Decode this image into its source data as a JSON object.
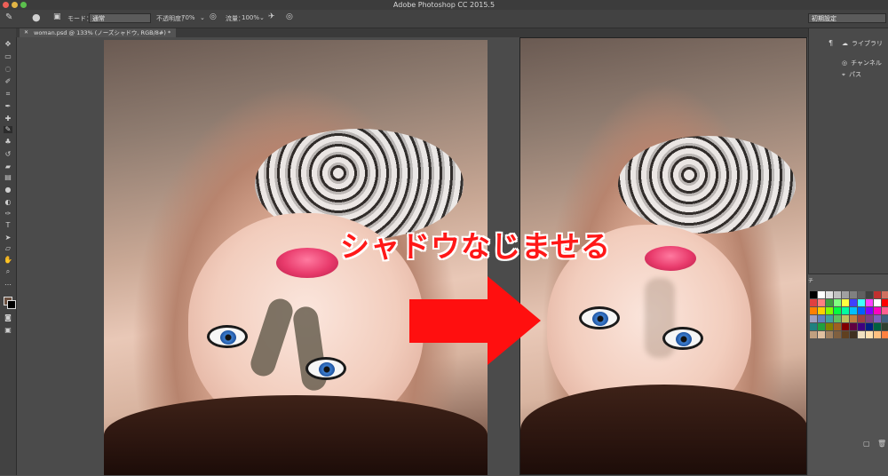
{
  "window": {
    "title": "Adobe Photoshop CC 2015.5"
  },
  "options_bar": {
    "mode_label": "モード：",
    "mode_value": "通常",
    "opacity_label": "不透明度：",
    "opacity_value": "70%",
    "flow_label": "流量：",
    "flow_value": "100%",
    "workspace": "初期設定"
  },
  "document_tab": {
    "title": "woman.psd @ 133% (ノーズシャドウ, RGB/8#) *"
  },
  "right_panel": {
    "items": [
      {
        "label": "ライブラリ",
        "icon": "libraries-icon"
      },
      {
        "label": "チャンネル",
        "icon": "channels-icon"
      },
      {
        "label": "パス",
        "icon": "paths-icon"
      }
    ]
  },
  "annotation": {
    "caption": "シャドウなじませる",
    "arrow_color": "#ff0f0f"
  },
  "swatch_colors": [
    "#000000",
    "#ffffff",
    "#e0e0e0",
    "#c0c0c0",
    "#a0a0a0",
    "#808080",
    "#606060",
    "#404040",
    "#c03030",
    "#d07060",
    "#e04040",
    "#ff8080",
    "#40a040",
    "#80ff80",
    "#ffff40",
    "#4040ff",
    "#40ffff",
    "#ff40ff",
    "#ffffff",
    "#ff0000",
    "#ff8000",
    "#ffd000",
    "#80ff00",
    "#00ff40",
    "#00ffa0",
    "#00c0ff",
    "#0060ff",
    "#8000ff",
    "#ff00c0",
    "#ff6090",
    "#a0a0c0",
    "#6080c0",
    "#40a0a0",
    "#60c060",
    "#c0c060",
    "#c08040",
    "#a04040",
    "#804080",
    "#8060c0",
    "#406080",
    "#208080",
    "#20a040",
    "#808000",
    "#a06020",
    "#800000",
    "#600040",
    "#400080",
    "#002080",
    "#006040",
    "#304030",
    "#c0a080",
    "#e0c0a0",
    "#a08060",
    "#806040",
    "#604020",
    "#403020",
    "#f0e0c0",
    "#ffe0b0",
    "#ffc080",
    "#ff8040"
  ]
}
